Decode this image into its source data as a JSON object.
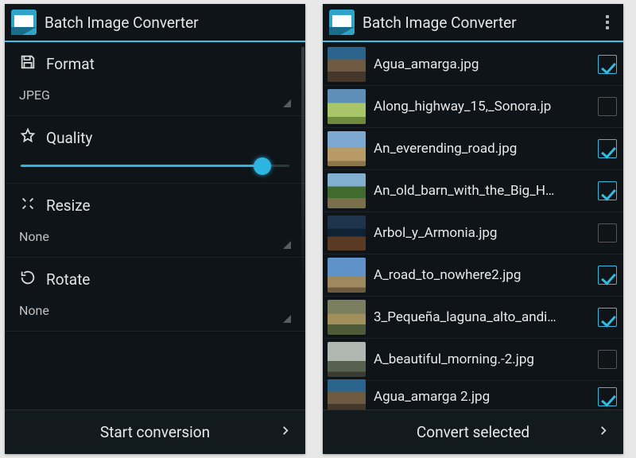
{
  "app_title": "Batch Image Converter",
  "left": {
    "sections": [
      {
        "key": "format",
        "label": "Format",
        "value": "JPEG",
        "control": "spinner"
      },
      {
        "key": "quality",
        "label": "Quality",
        "value": 90,
        "control": "slider"
      },
      {
        "key": "resize",
        "label": "Resize",
        "value": "None",
        "control": "spinner"
      },
      {
        "key": "rotate",
        "label": "Rotate",
        "value": "None",
        "control": "spinner"
      }
    ],
    "primary_action": "Start conversion"
  },
  "right": {
    "files": [
      {
        "name": "Agua_amarga.jpg",
        "checked": true,
        "thumb": "linear-gradient(#2a648c 0 35%,#6d5a41 35% 70%,#45382a 70%)"
      },
      {
        "name": "Along_highway_15,_Sonora.jp",
        "checked": false,
        "thumb": "linear-gradient(#5f8fb8 0 40%,#a9c56a 40% 80%,#6f8a3c 80%)"
      },
      {
        "name": "An_everending_road.jpg",
        "checked": true,
        "thumb": "linear-gradient(#7da8d0 0 45%,#b89a66 45% 85%,#8c744b 85%)"
      },
      {
        "name": "An_old_barn_with_the_Big_H…",
        "checked": true,
        "thumb": "linear-gradient(#82aed0 0 38%,#3f6b2e 38% 70%,#7b6e4a 70%)"
      },
      {
        "name": "Arbol_y_Armonia.jpg",
        "checked": false,
        "thumb": "linear-gradient(#1e334c 0 38%,#0e2233 38% 60%,#5a3a22 60%)"
      },
      {
        "name": "A_road_to_nowhere2.jpg",
        "checked": true,
        "thumb": "linear-gradient(#5f93c8 0 55%,#9f8760 55% 85%,#6e5a3c 85%)"
      },
      {
        "name": "3_Pequeña_laguna_alto_andi…",
        "checked": true,
        "thumb": "linear-gradient(#7a7f60 0 40%,#a28f5c 40% 70%,#4f5a38 70%)"
      },
      {
        "name": "A_beautiful_morning.-2.jpg",
        "checked": false,
        "thumb": "linear-gradient(#b0b6b0 0 55%,#586050 55% 85%,#383c33 85%)"
      },
      {
        "name": "Agua_amarga 2.jpg",
        "checked": true,
        "thumb": "linear-gradient(#2a648c 0 35%,#6d5a41 35% 70%,#45382a 70%)"
      }
    ],
    "primary_action": "Convert selected"
  }
}
